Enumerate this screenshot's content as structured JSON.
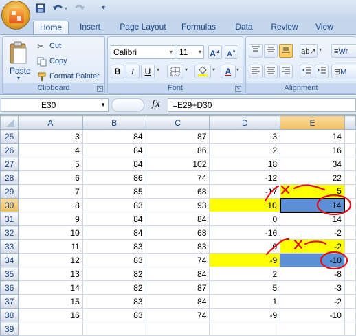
{
  "quick_access": {
    "items": [
      "save-icon",
      "undo-icon",
      "redo-icon",
      "customize-icon"
    ]
  },
  "tabs": [
    {
      "label": "Home",
      "active": true
    },
    {
      "label": "Insert"
    },
    {
      "label": "Page Layout"
    },
    {
      "label": "Formulas"
    },
    {
      "label": "Data"
    },
    {
      "label": "Review"
    },
    {
      "label": "View"
    }
  ],
  "clipboard": {
    "paste": "Paste",
    "cut": "Cut",
    "copy": "Copy",
    "format_painter": "Format Painter",
    "label": "Clipboard"
  },
  "font": {
    "name": "Calibri",
    "size": "11",
    "bold": "B",
    "italic": "I",
    "underline": "U",
    "grow": "A",
    "shrink": "A",
    "color_button": "A",
    "label": "Font"
  },
  "alignment": {
    "label": "Alignment",
    "wrap_partial": "Wr",
    "merge_partial": "M"
  },
  "formula_bar": {
    "name_box": "E30",
    "fx": "fx",
    "formula": "=E29+D30"
  },
  "columns": [
    {
      "label": "A"
    },
    {
      "label": "B"
    },
    {
      "label": "C"
    },
    {
      "label": "D"
    },
    {
      "label": "E",
      "selected": true
    }
  ],
  "rows": [
    {
      "num": "25",
      "cells": [
        "3",
        "84",
        "87",
        "3",
        "14"
      ]
    },
    {
      "num": "26",
      "cells": [
        "4",
        "84",
        "86",
        "2",
        "16"
      ]
    },
    {
      "num": "27",
      "cells": [
        "5",
        "84",
        "102",
        "18",
        "34"
      ]
    },
    {
      "num": "28",
      "cells": [
        "6",
        "86",
        "74",
        "-12",
        "22"
      ]
    },
    {
      "num": "29",
      "cells": [
        "7",
        "85",
        "68",
        "-17",
        "5"
      ]
    },
    {
      "num": "30",
      "cells": [
        "8",
        "83",
        "93",
        "10",
        "14"
      ],
      "selected": true
    },
    {
      "num": "31",
      "cells": [
        "9",
        "84",
        "84",
        "0",
        "14"
      ]
    },
    {
      "num": "32",
      "cells": [
        "10",
        "84",
        "68",
        "-16",
        "-2"
      ]
    },
    {
      "num": "33",
      "cells": [
        "11",
        "83",
        "83",
        "0",
        "-2"
      ]
    },
    {
      "num": "34",
      "cells": [
        "12",
        "83",
        "74",
        "-9",
        "-10"
      ]
    },
    {
      "num": "35",
      "cells": [
        "13",
        "82",
        "84",
        "2",
        "-8"
      ]
    },
    {
      "num": "36",
      "cells": [
        "14",
        "82",
        "87",
        "5",
        "-3"
      ]
    },
    {
      "num": "37",
      "cells": [
        "15",
        "83",
        "84",
        "1",
        "-2"
      ]
    },
    {
      "num": "38",
      "cells": [
        "16",
        "83",
        "74",
        "-9",
        "-10"
      ]
    },
    {
      "num": "39",
      "cells": [
        "",
        "",
        "",
        "",
        ""
      ]
    }
  ],
  "highlights": {
    "yellow": "#ffff00",
    "blue": "#5b8fd6",
    "annotation_red": "#e0101a"
  }
}
